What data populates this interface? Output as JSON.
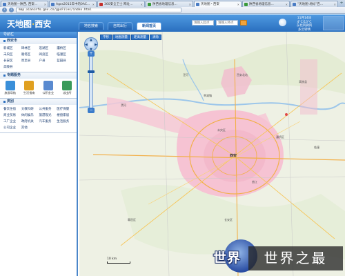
{
  "browser": {
    "tabs": [
      {
        "label": "天地图—陕西, 西安...",
        "active": false,
        "style": "blue"
      },
      {
        "label": "Agos2015年中的0AC...",
        "active": false,
        "style": "blue"
      },
      {
        "label": "360安全卫士 网址...",
        "active": false,
        "style": "red"
      },
      {
        "label": "陕西省地理信息...",
        "active": false,
        "style": "green"
      },
      {
        "label": "天地图・西安",
        "active": true,
        "style": "blue"
      },
      {
        "label": "陕西省地理信息...",
        "active": false,
        "style": "green"
      },
      {
        "label": "\"天地图-地标\"百...",
        "active": false,
        "style": "blue"
      }
    ],
    "url": "map.xianinfo.gov.cn/gpsFiles/index.html"
  },
  "header": {
    "logo_text": "天地图",
    "logo_sep": "·",
    "logo_city": "西安",
    "nav": [
      {
        "label": "地名搜索",
        "active": false
      },
      {
        "label": "自驾出行",
        "active": false
      },
      {
        "label": "新闻首页",
        "active": true
      }
    ],
    "search_placeholder_1": "请输入起点",
    "search_placeholder_2": "请输入终点",
    "date": "11月14日",
    "temp": "4°C/13°C",
    "weather": "东北风微风",
    "city": "多云转晴"
  },
  "sidebar": {
    "title": "导航栏",
    "districts_title": "西安市",
    "districts": [
      "新城区",
      "碑林区",
      "莲湖区",
      "灞桥区",
      "未央区",
      "雁塔区",
      "阎良区",
      "临潼区",
      "长安区",
      "周至县",
      "户县",
      "蓝田县",
      "高陵县"
    ],
    "services_title": "专题服务",
    "services": [
      {
        "label": "旅游导航",
        "color": "#3a8fd9"
      },
      {
        "label": "生活指南",
        "color": "#e0a020"
      },
      {
        "label": "公积金业",
        "color": "#5a8ad0"
      },
      {
        "label": "派出所",
        "color": "#3a9a5a"
      }
    ],
    "categories_title": "类别",
    "categories": [
      "餐饮住宿",
      "文教科研",
      "公共服务",
      "医疗保健",
      "商业贸易",
      "休闲娱乐",
      "旅游观光",
      "楼盘家居",
      "工厂企业",
      "政府机关",
      "汽车服务",
      "生活服务",
      "公司企业",
      "其他"
    ]
  },
  "map": {
    "tools": [
      "平移",
      "地图测量",
      "距离测量",
      "清除"
    ],
    "scale_label": "10 km",
    "labels": [
      "西安北站",
      "泾河",
      "渭河",
      "草滩镇",
      "西安",
      "曲江",
      "高陵县",
      "临潼",
      "未央区",
      "长安区",
      "鄠邑区",
      "灞桥区"
    ],
    "colors": {
      "urban": "#f6c8d6",
      "road_main": "#f2b04a",
      "water": "#9cc6ea",
      "green": "#cfe4b8"
    }
  },
  "watermark": {
    "badge": "世界",
    "text": "世界之最"
  }
}
